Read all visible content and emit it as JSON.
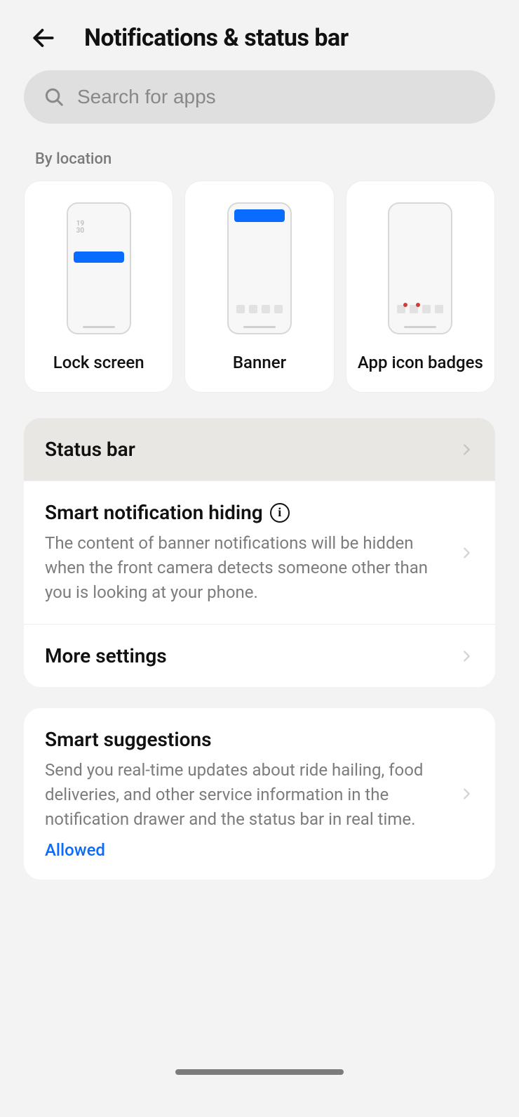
{
  "header": {
    "title": "Notifications & status bar"
  },
  "search": {
    "placeholder": "Search for apps"
  },
  "by_location": {
    "label": "By location",
    "cards": [
      {
        "title": "Lock screen"
      },
      {
        "title": "Banner"
      },
      {
        "title": "App icon badges"
      }
    ]
  },
  "rows": {
    "status_bar": {
      "title": "Status bar"
    },
    "smart_hiding": {
      "title": "Smart notification hiding",
      "desc": "The content of banner notifications will be hidden when the front camera detects someone other than you is looking at your phone."
    },
    "more_settings": {
      "title": "More settings"
    },
    "smart_suggestions": {
      "title": "Smart suggestions",
      "desc": "Send you real-time updates about ride hailing, food deliveries, and other service information in the notification drawer and the status bar in real time.",
      "status": "Allowed"
    }
  },
  "phone_preview": {
    "time_line1": "19",
    "time_line2": "30"
  }
}
